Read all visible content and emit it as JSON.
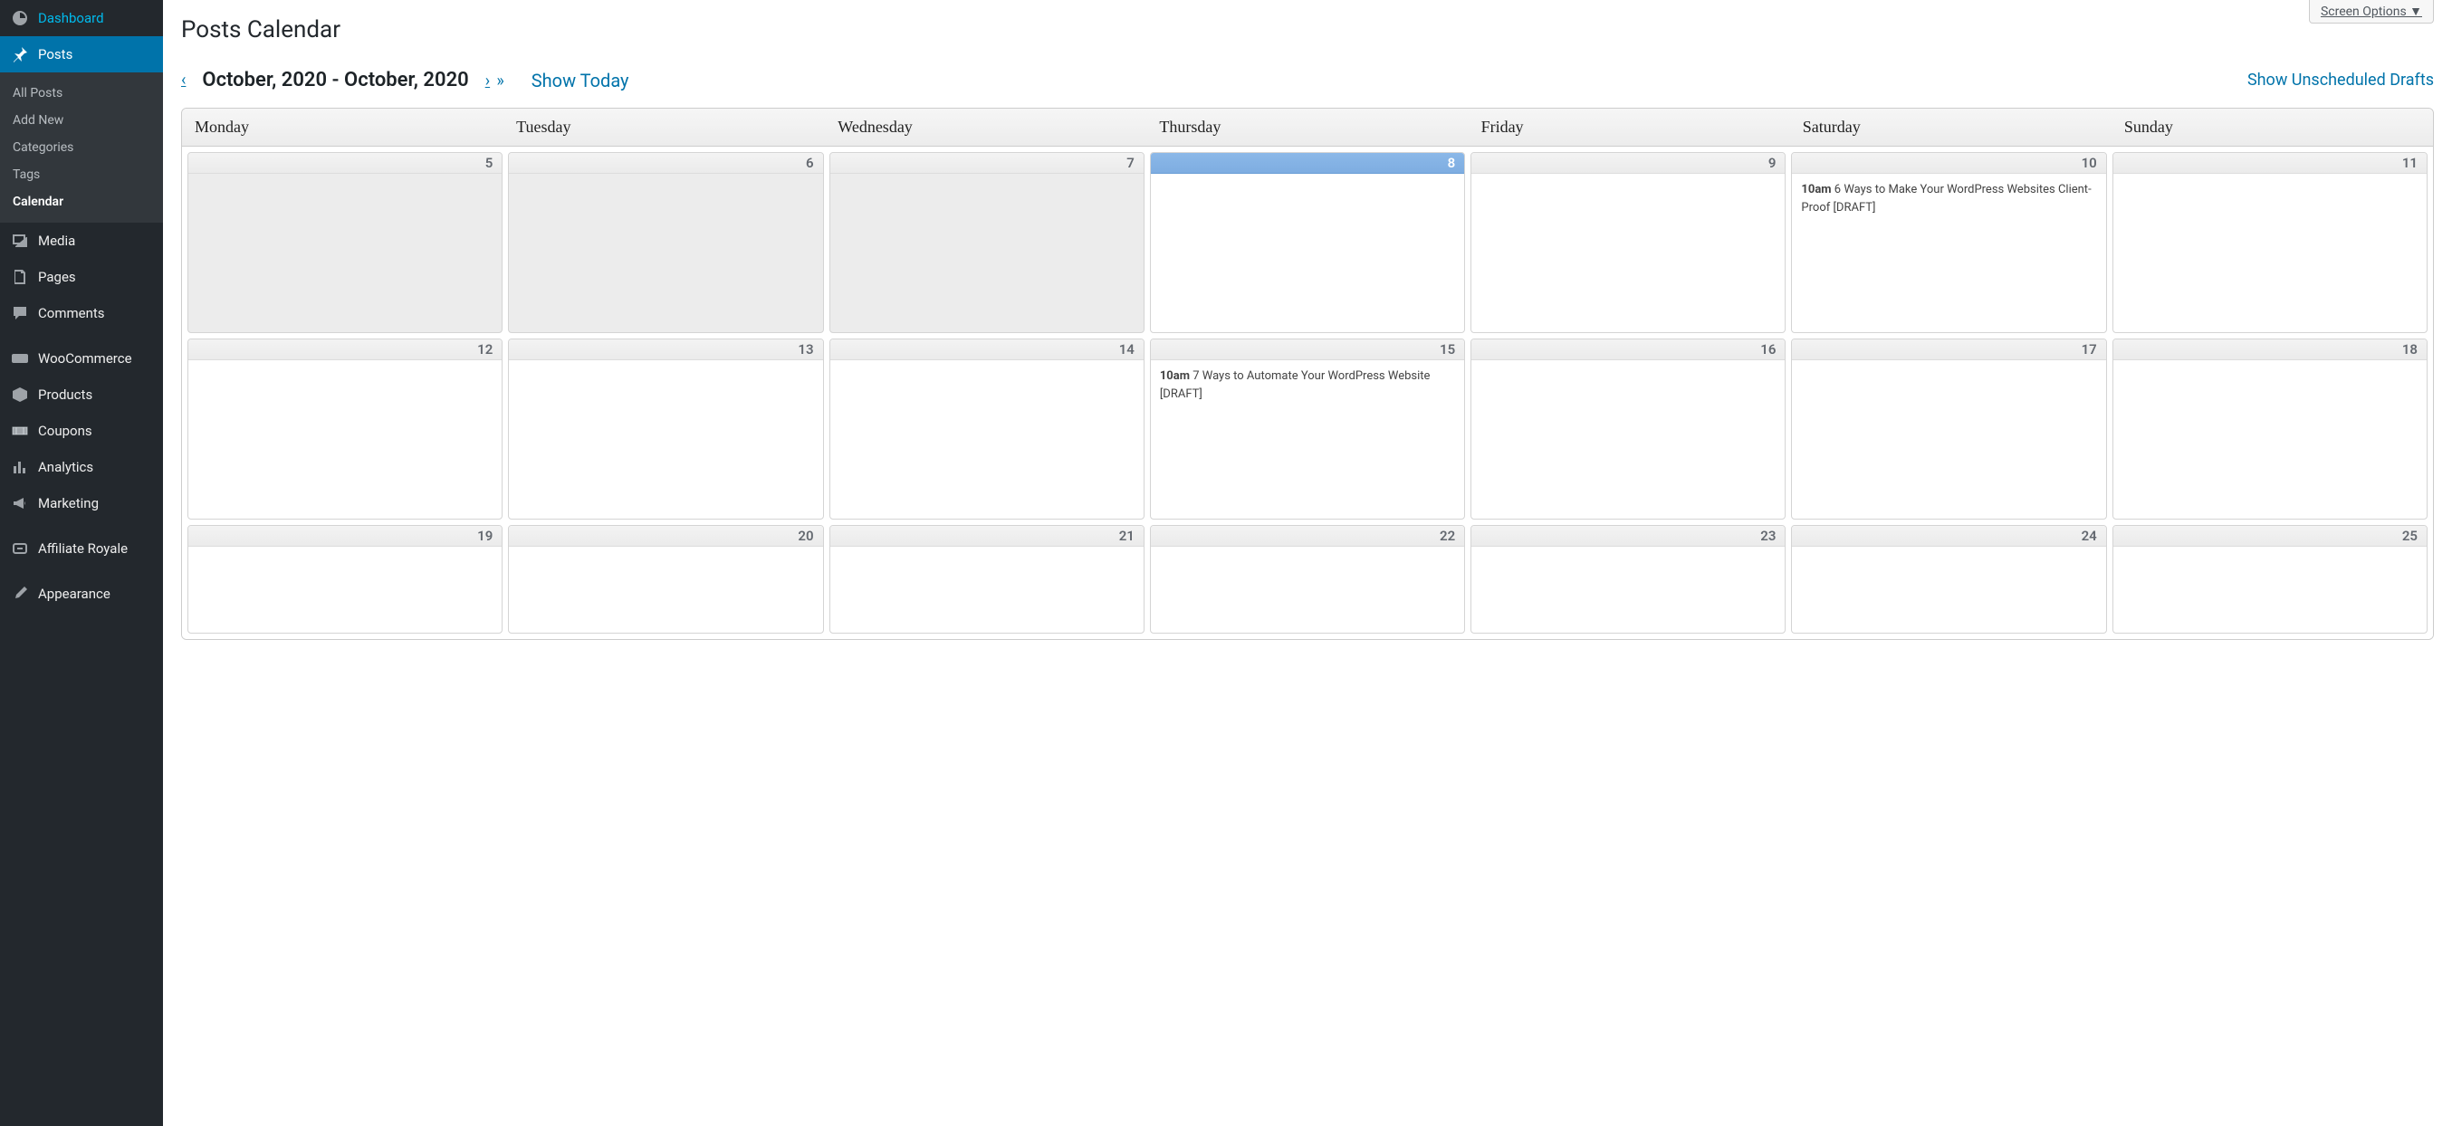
{
  "screen_options_label": "Screen Options  ▼",
  "page_title": "Posts Calendar",
  "nav": {
    "prev_single": "‹",
    "range": "October, 2020 - October, 2020",
    "next_single": "›",
    "next_double": "»",
    "show_today": "Show Today",
    "show_drafts": "Show Unscheduled Drafts"
  },
  "sidebar": {
    "items": [
      {
        "label": "Dashboard",
        "icon": "dashboard"
      },
      {
        "label": "Posts",
        "icon": "posts",
        "active": true
      },
      {
        "label": "Media",
        "icon": "media"
      },
      {
        "label": "Pages",
        "icon": "pages"
      },
      {
        "label": "Comments",
        "icon": "comments"
      },
      {
        "label": "WooCommerce",
        "icon": "woo"
      },
      {
        "label": "Products",
        "icon": "products"
      },
      {
        "label": "Coupons",
        "icon": "coupons"
      },
      {
        "label": "Analytics",
        "icon": "analytics"
      },
      {
        "label": "Marketing",
        "icon": "marketing"
      },
      {
        "label": "Affiliate Royale",
        "icon": "affiliate"
      },
      {
        "label": "Appearance",
        "icon": "appearance"
      }
    ],
    "posts_submenu": [
      {
        "label": "All Posts"
      },
      {
        "label": "Add New"
      },
      {
        "label": "Categories"
      },
      {
        "label": "Tags"
      },
      {
        "label": "Calendar",
        "current": true
      }
    ]
  },
  "calendar": {
    "weekday_headers": [
      "Monday",
      "Tuesday",
      "Wednesday",
      "Thursday",
      "Friday",
      "Saturday",
      "Sunday"
    ],
    "weeks": [
      [
        {
          "day": 5,
          "past": true
        },
        {
          "day": 6,
          "past": true
        },
        {
          "day": 7,
          "past": true
        },
        {
          "day": 8,
          "today": true
        },
        {
          "day": 9
        },
        {
          "day": 10,
          "events": [
            {
              "time": "10am",
              "title": "6 Ways to Make Your WordPress Websites Client-Proof [DRAFT]"
            }
          ]
        },
        {
          "day": 11
        }
      ],
      [
        {
          "day": 12
        },
        {
          "day": 13
        },
        {
          "day": 14
        },
        {
          "day": 15,
          "events": [
            {
              "time": "10am",
              "title": "7 Ways to Automate Your WordPress Website [DRAFT]"
            }
          ]
        },
        {
          "day": 16
        },
        {
          "day": 17
        },
        {
          "day": 18
        }
      ],
      [
        {
          "day": 19
        },
        {
          "day": 20
        },
        {
          "day": 21
        },
        {
          "day": 22
        },
        {
          "day": 23
        },
        {
          "day": 24
        },
        {
          "day": 25
        }
      ]
    ]
  }
}
